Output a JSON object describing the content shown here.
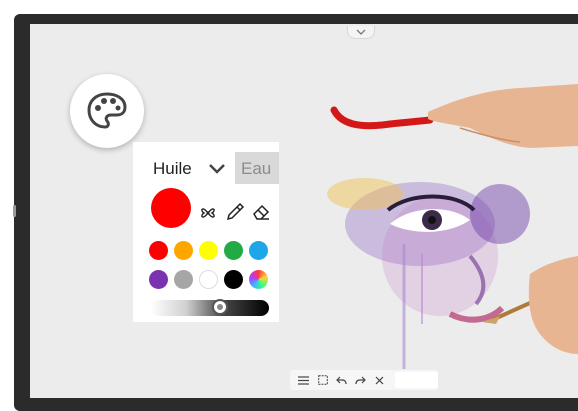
{
  "panel": {
    "tabs": [
      {
        "label": "Huile",
        "active": true
      },
      {
        "label": "Eau",
        "active": false
      }
    ],
    "current_color": "#ff0000",
    "tools": [
      "fan-brush-icon",
      "eyedropper-icon",
      "eraser-icon"
    ],
    "swatches": [
      "#ff0000",
      "#ffa500",
      "#ffff00",
      "#22aa44",
      "#1ea7e8",
      "#7a33b0",
      "#a6a6a6",
      "#ffffff",
      "#000000",
      "gradient"
    ],
    "opacity_level": 0.6
  },
  "toolbar": {
    "buttons": [
      "menu-icon",
      "select-icon",
      "undo-icon",
      "redo-icon",
      "close-icon"
    ]
  },
  "colors": {
    "frame": "#2b2b2b",
    "screen": "#ececec"
  }
}
